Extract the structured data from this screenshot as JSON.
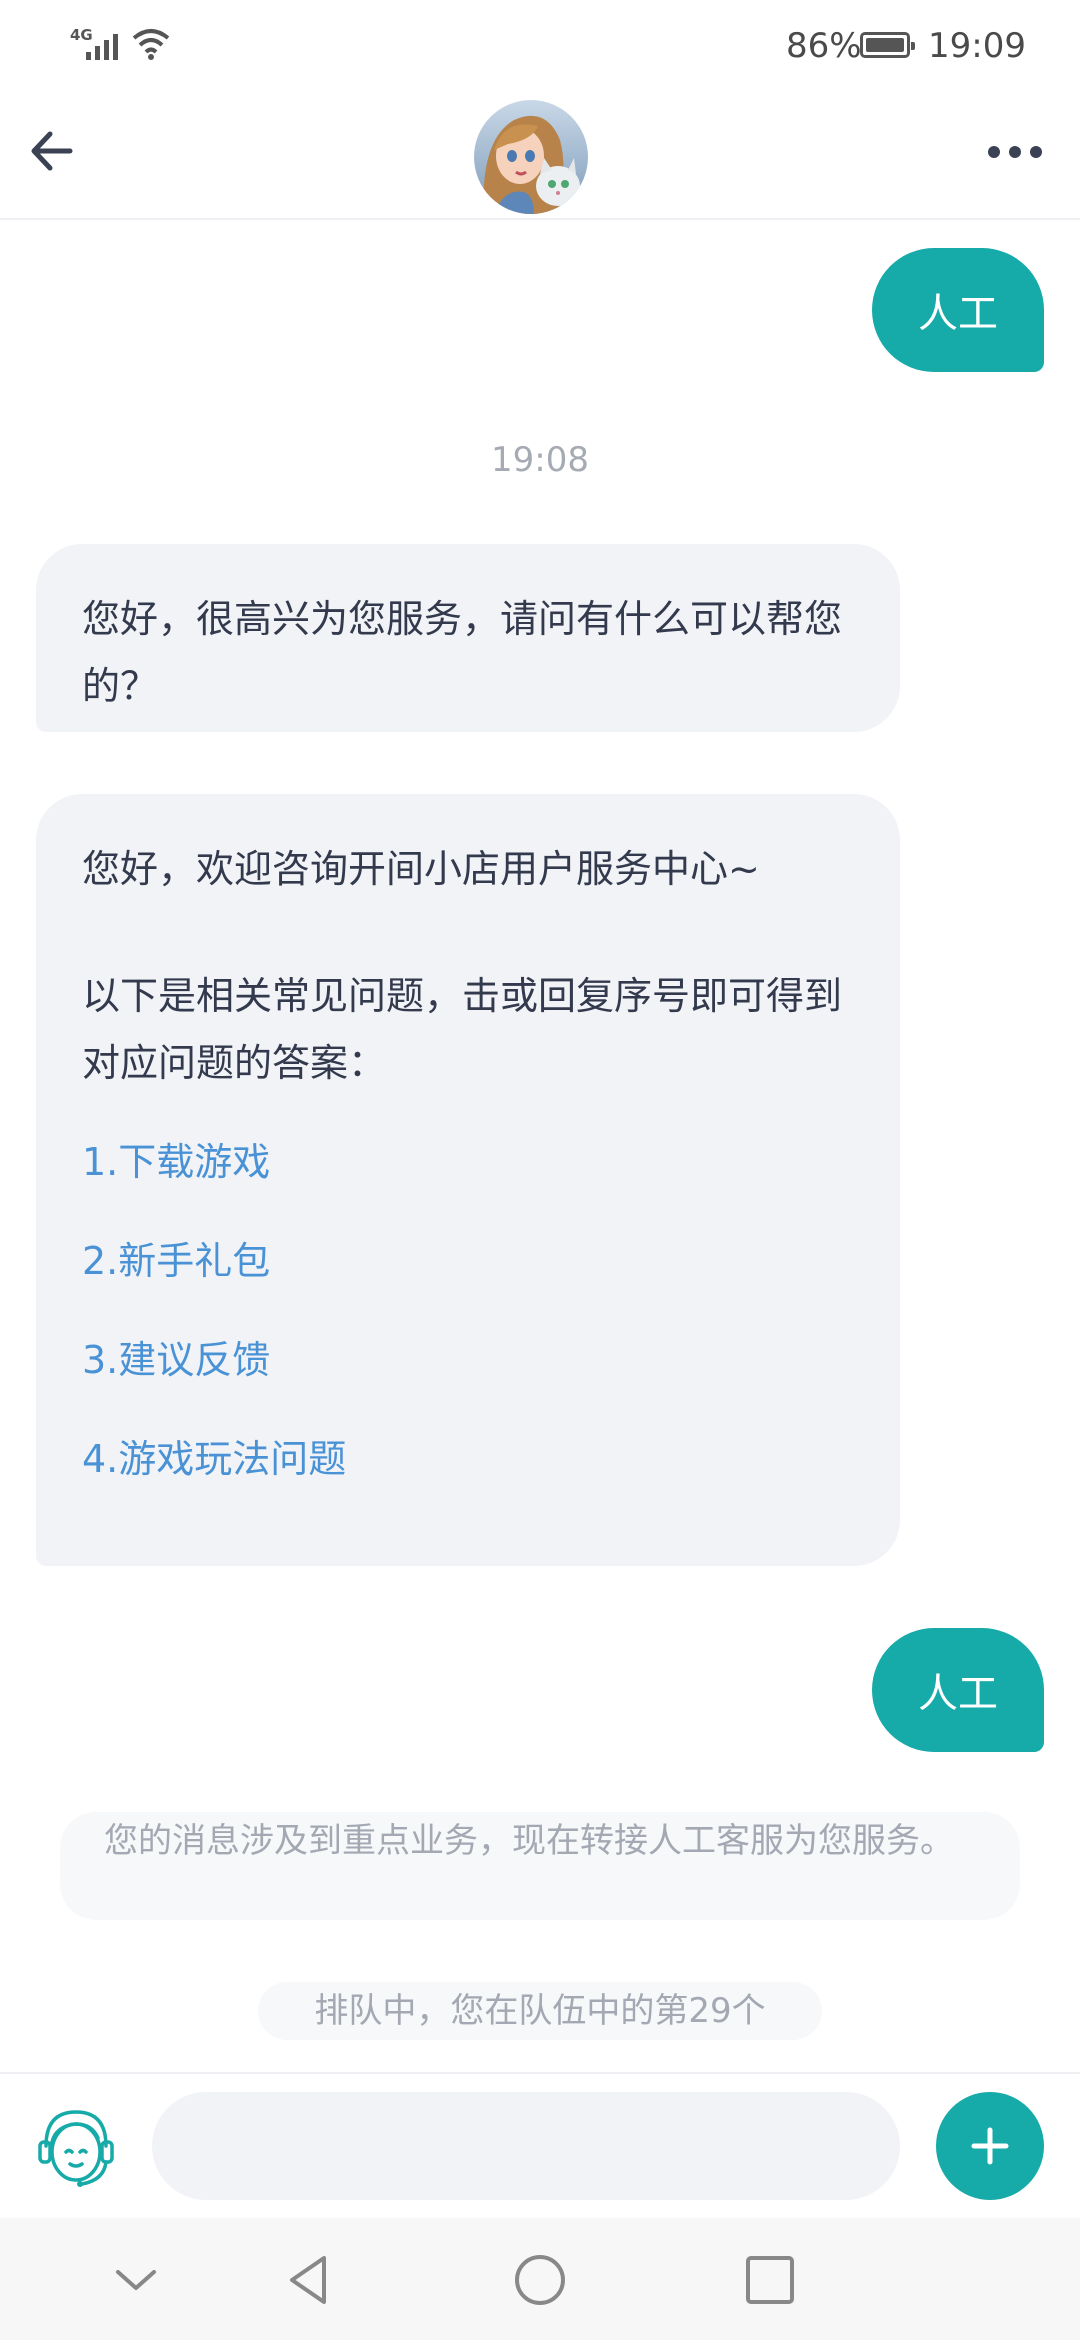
{
  "status_bar": {
    "network": "4G",
    "battery_percent": "86%",
    "battery_level": 0.86,
    "time": "19:09"
  },
  "header": {
    "avatar": "game-character-avatar",
    "menu_icon": "more-dots-icon"
  },
  "messages": {
    "sent_1": "人工",
    "timestamp": "19:08",
    "greeting": "您好，很高兴为您服务，请问有什么可以帮您的？",
    "faq_intro": "您好，欢迎咨询开间小店用户服务中心~",
    "faq_prompt": "以下是相关常见问题，击或回复序号即可得到对应问题的答案：",
    "faq_options": [
      "1.下载游戏",
      "2.新手礼包",
      "3.建议反馈",
      "4.游戏玩法问题"
    ],
    "sent_2": "人工",
    "transfer_notice": "您的消息涉及到重点业务，现在转接人工客服为您服务。",
    "queue_status": "排队中，您在队伍中的第29个"
  },
  "input_bar": {
    "agent_icon": "customer-service-icon",
    "placeholder": "",
    "value": "",
    "add_icon": "plus-icon"
  },
  "colors": {
    "accent": "#16aaa8",
    "link": "#4a92d6",
    "bubble_bg": "#f1f3f6"
  }
}
